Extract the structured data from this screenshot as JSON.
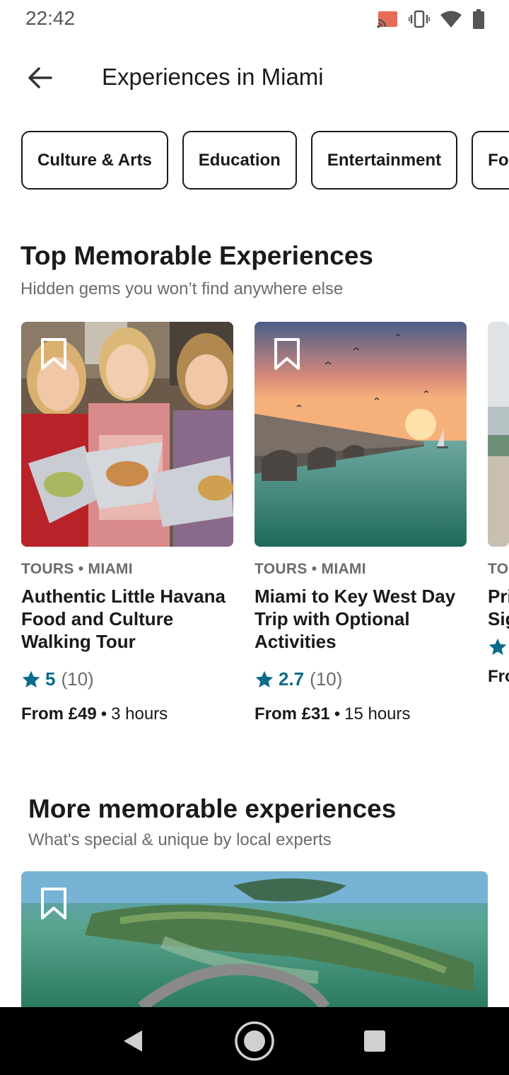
{
  "status_bar": {
    "time": "22:42",
    "icons": [
      "cast-icon",
      "vibrate-icon",
      "wifi-icon",
      "battery-icon"
    ]
  },
  "app_bar": {
    "back_icon": "arrow-left-icon",
    "title": "Experiences in Miami"
  },
  "categories": [
    {
      "label": "Culture & Arts"
    },
    {
      "label": "Education"
    },
    {
      "label": "Entertainment"
    },
    {
      "label": "Fo"
    }
  ],
  "section_top": {
    "title": "Top Memorable Experiences",
    "subtitle": "Hidden gems you won’t find anywhere else"
  },
  "cards": [
    {
      "meta": "TOURS • MIAMI",
      "title": "Authentic Little Havana Food and Culture Walking Tour",
      "rating": "5",
      "reviews": "(10)",
      "price": "From £49",
      "duration": "3 hours",
      "bookmarked": false
    },
    {
      "meta": "TOURS • MIAMI",
      "title": "Miami to Key West Day Trip with Optional Activities",
      "rating": "2.7",
      "reviews": "(10)",
      "price": "From £31",
      "duration": "15 hours",
      "bookmarked": false
    },
    {
      "meta": "TO",
      "title_line1": "Pri",
      "title_line2": "Sig",
      "price": "Fro"
    }
  ],
  "section_more": {
    "title": "More memorable experiences",
    "subtitle": "What's special & unique by local experts"
  },
  "separator": "•",
  "colors": {
    "accent": "#0b6b8a",
    "text": "#1a1a1a",
    "muted": "#6b6b6b",
    "nav_bar": "#000000"
  }
}
